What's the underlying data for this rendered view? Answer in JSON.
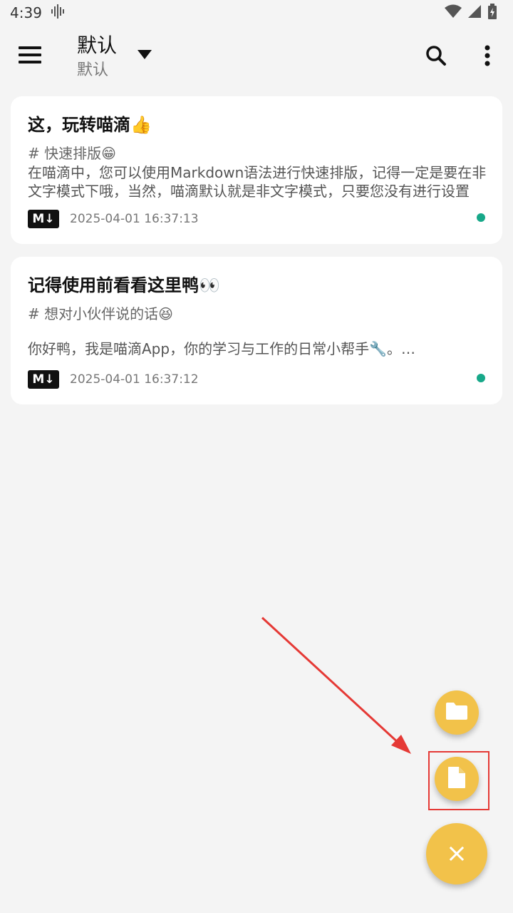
{
  "status_bar": {
    "time": "4:39"
  },
  "toolbar": {
    "title": "默认",
    "subtitle": "默认"
  },
  "notes": [
    {
      "title": "这，玩转喵滴👍",
      "tag": "# 快速排版😁",
      "body": "在喵滴中，您可以使用Markdown语法进行快速排版，记得一定是要在非文字模式下哦，当然，喵滴默认就是非文字模式，只要您没有进行设置",
      "format": "M↓",
      "date": "2025-04-01 16:37:13"
    },
    {
      "title": "记得使用前看看这里鸭👀",
      "tag": "# 想对小伙伴说的话😆",
      "body": "你好鸭，我是喵滴App，你的学习与工作的日常小帮手🔧。…",
      "format": "M↓",
      "date": "2025-04-01 16:37:12"
    }
  ],
  "fab_close_label": "×",
  "colors": {
    "fab": "#f2c24a",
    "sync": "#17a889",
    "annotation": "#e53935"
  }
}
